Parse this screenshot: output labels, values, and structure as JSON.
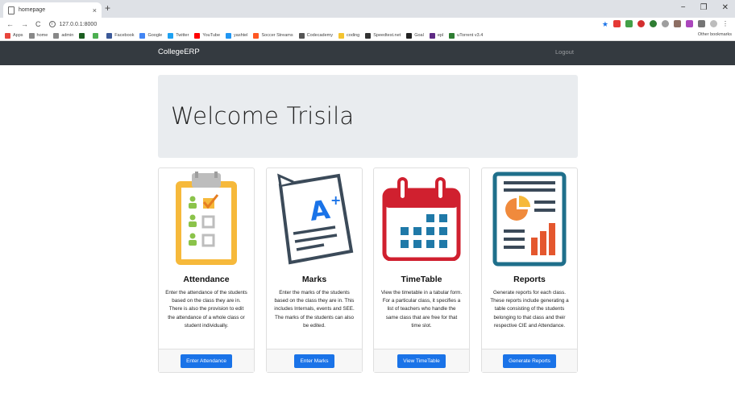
{
  "browser": {
    "tab_title": "homepage",
    "tab_close": "×",
    "new_tab": "+",
    "url": "127.0.0.1:8000",
    "window_controls": [
      "−",
      "❐",
      "✕"
    ],
    "bookmarks": [
      {
        "label": "Apps",
        "color": "#e8453c"
      },
      {
        "label": "home",
        "color": "#888"
      },
      {
        "label": "admin",
        "color": "#888"
      },
      {
        "label": "",
        "color": "#1b5e20"
      },
      {
        "label": "",
        "color": "#4caf50"
      },
      {
        "label": "Facebook",
        "color": "#3b5998"
      },
      {
        "label": "Google",
        "color": "#4285f4"
      },
      {
        "label": "Twitter",
        "color": "#1da1f2"
      },
      {
        "label": "YouTube",
        "color": "#ff0000"
      },
      {
        "label": "yashtel",
        "color": "#2196f3"
      },
      {
        "label": "Soccer Streams",
        "color": "#ff5722"
      },
      {
        "label": "Codecademy",
        "color": "#555"
      },
      {
        "label": "coding",
        "color": "#f4c430"
      },
      {
        "label": "Speedtest.net",
        "color": "#333"
      },
      {
        "label": "Goal",
        "color": "#222"
      },
      {
        "label": "epl",
        "color": "#5e2a84"
      },
      {
        "label": "uTorrent v3.4",
        "color": "#2e7d32"
      }
    ],
    "other_bookmarks": "Other bookmarks"
  },
  "navbar": {
    "brand": "CollegeERP",
    "logout": "Logout"
  },
  "jumbotron": {
    "heading": "Welcome Trisila"
  },
  "cards": [
    {
      "title": "Attendance",
      "text": "Enter the attendance of the students based on the class they are in. There is also the provision to edit the attendance of a whole class or student individually.",
      "button": "Enter Attendance",
      "icon": "clipboard-checklist-icon"
    },
    {
      "title": "Marks",
      "text": "Enter the marks of the students based on the class they are in. This includes Internals, events and SEE. The marks of the students can also be edited.",
      "button": "Enter Marks",
      "icon": "graded-paper-icon"
    },
    {
      "title": "TimeTable",
      "text": "View the timetable in a tabular form. For a particular class, it specifies a list of teachers who handle the same class that are free for that time slot.",
      "button": "View TimeTable",
      "icon": "calendar-icon"
    },
    {
      "title": "Reports",
      "text": "Generate reports for each class. These reports include generating a table consisting of the students belonging to that class and their respective CIE and Attendance.",
      "button": "Generate Reports",
      "icon": "report-chart-icon"
    }
  ],
  "colors": {
    "navbar": "#343a40",
    "button": "#1a73e8",
    "jumbotron": "#e9ecef"
  }
}
